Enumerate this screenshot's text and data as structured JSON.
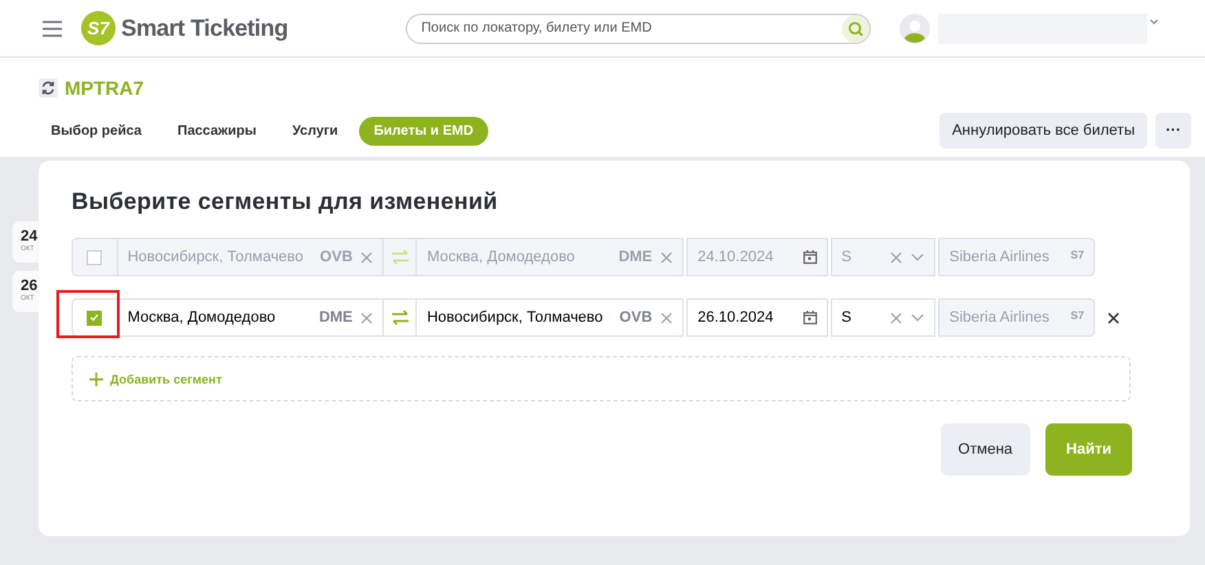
{
  "header": {
    "logo_mark": "S7",
    "app_name": "Smart Ticketing",
    "search": {
      "placeholder": "Поиск по локатору, билету или EMD"
    }
  },
  "booking": {
    "locator": "MPTRA7"
  },
  "tabs": [
    {
      "label": "Выбор рейса",
      "selected": false
    },
    {
      "label": "Пассажиры",
      "selected": false
    },
    {
      "label": "Услуги",
      "selected": false
    },
    {
      "label": "Билеты и EMD",
      "selected": true
    }
  ],
  "actions": {
    "cancel_all": "Аннулировать все билеты",
    "more": "···"
  },
  "background_cards": [
    {
      "day": "24",
      "month": "ОКТ"
    },
    {
      "day": "26",
      "month": "ОКТ"
    }
  ],
  "dialog": {
    "title": "Выберите сегменты для изменений",
    "segments": [
      {
        "checked": false,
        "disabled": true,
        "highlighted": false,
        "removable": false,
        "from": {
          "name": "Новосибирск, Толмачево",
          "code": "OVB"
        },
        "to": {
          "name": "Москва, Домодедово",
          "code": "DME"
        },
        "date": "24.10.2024",
        "class": "S",
        "airline": "Siberia Airlines",
        "airline_code": "S7"
      },
      {
        "checked": true,
        "disabled": false,
        "highlighted": true,
        "removable": true,
        "from": {
          "name": "Москва, Домодедово",
          "code": "DME"
        },
        "to": {
          "name": "Новосибирск, Толмачево",
          "code": "OVB"
        },
        "date": "26.10.2024",
        "class": "S",
        "airline": "Siberia Airlines",
        "airline_code": "S7"
      }
    ],
    "add_segment": "Добавить сегмент",
    "buttons": [
      {
        "kind": "secondary",
        "label": "Отмена"
      },
      {
        "kind": "primary",
        "label": "Найти"
      }
    ]
  }
}
